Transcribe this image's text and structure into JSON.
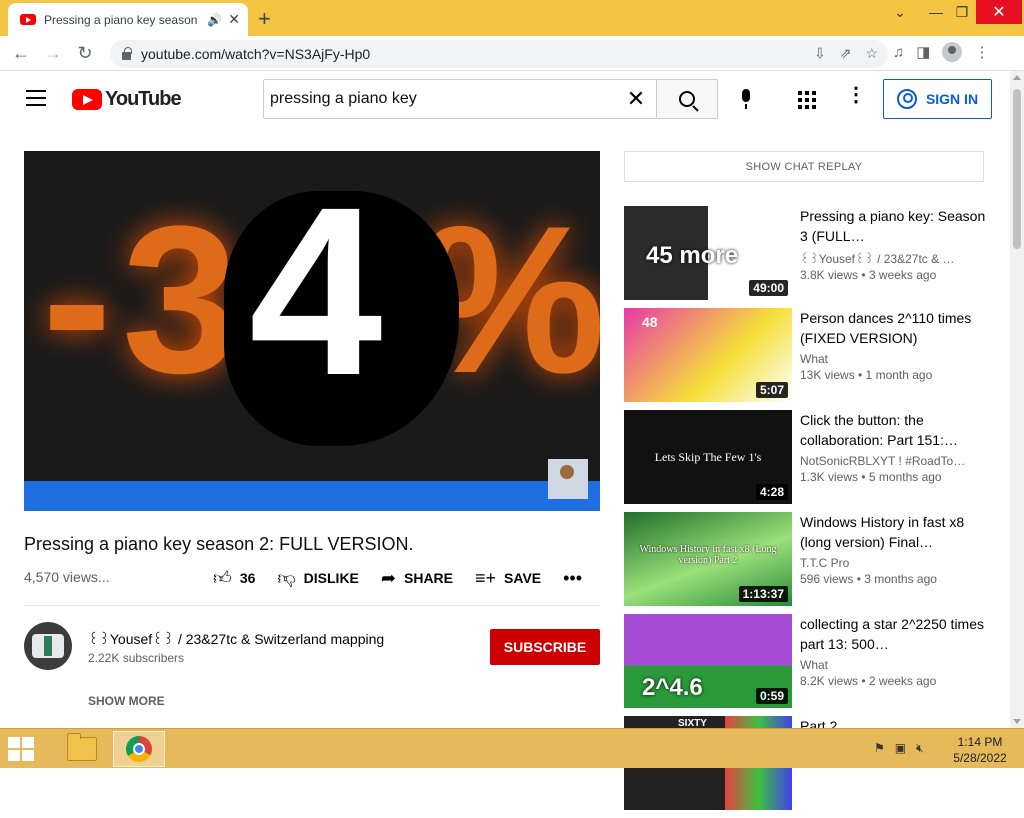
{
  "browser": {
    "tab_title": "Pressing a piano key season",
    "url": "youtube.com/watch?v=NS3AjFy-Hp0"
  },
  "youtube": {
    "logo_text": "YouTube",
    "search_value": "pressing a piano key",
    "sign_in_label": "SIGN IN"
  },
  "video": {
    "overlay_left": "-3",
    "overlay_right": "%",
    "overlay_number": "4",
    "title": "Pressing a piano key season 2: FULL VERSION.",
    "views": "4,570 views...",
    "likes": "36",
    "dislike_label": "DISLIKE",
    "share_label": "SHARE",
    "save_label": "SAVE"
  },
  "channel": {
    "name": "꒰꒱Yousef꒰꒱ / 23&27tc & Switzerland mapping",
    "subscribers": "2.22K subscribers",
    "subscribe_label": "SUBSCRIBE",
    "show_more_label": "SHOW MORE"
  },
  "chat_replay_label": "SHOW CHAT REPLAY",
  "recommendations": [
    {
      "title": "Pressing a piano key: Season 3 (FULL…",
      "channel": "꒰꒱Yousef꒰꒱ / 23&27tc & …",
      "stats": "3.8K views • 3 weeks ago",
      "duration": "49:00",
      "thumb_text": "45 more",
      "colors": [
        "#2b2b2b",
        "#ffffff"
      ]
    },
    {
      "title": "Person dances 2^110 times (FIXED VERSION)",
      "channel": "What",
      "stats": "13K views • 1 month ago",
      "duration": "5:07",
      "thumb_text": "48 ",
      "colors": [
        "#e83aa6",
        "#f6e03a"
      ]
    },
    {
      "title": "Click the button: the collaboration: Part 151:…",
      "channel": "NotSonicRBLXYT ! #RoadTo…",
      "stats": "1.3K views • 5 months ago",
      "duration": "4:28",
      "thumb_text": "Lets Skip The Few 1's",
      "colors": [
        "#111111",
        "#ffffff"
      ]
    },
    {
      "title": "Windows History in fast x8 (long version) Final…",
      "channel": "T.T.C Pro",
      "stats": "596 views • 3 months ago",
      "duration": "1:13:37",
      "thumb_text": "Windows History in fast x8 (Long version) Part 2",
      "colors": [
        "#2a8a3a",
        "#9be07a"
      ]
    },
    {
      "title": "collecting a star 2^2250 times part 13: 500…",
      "channel": "What",
      "stats": "8.2K views • 2 weeks ago",
      "duration": "0:59",
      "thumb_text": "2^4.6",
      "colors": [
        "#a64cd6",
        "#2a9a3a"
      ]
    },
    {
      "title": "Part 2",
      "channel": "",
      "stats": "",
      "duration": "",
      "thumb_text": "SIXTY",
      "colors": [
        "#222222",
        "#e84040"
      ]
    }
  ],
  "taskbar": {
    "time": "1:14 PM",
    "date": "5/28/2022"
  }
}
